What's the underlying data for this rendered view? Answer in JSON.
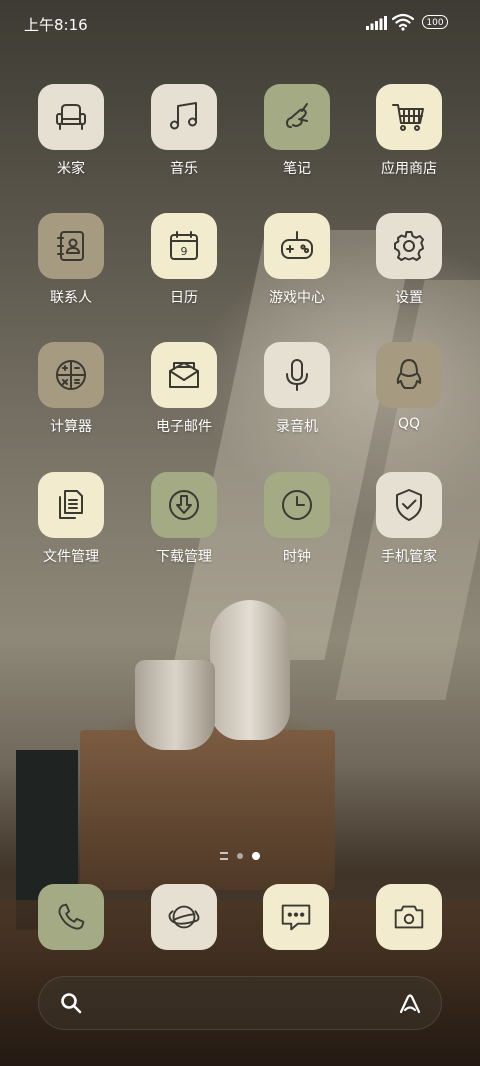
{
  "status": {
    "time": "上午8:16",
    "battery": "100"
  },
  "apps": [
    {
      "label": "米家",
      "icon": "mijia-chair-icon"
    },
    {
      "label": "音乐",
      "icon": "music-note-icon"
    },
    {
      "label": "笔记",
      "icon": "notes-icon"
    },
    {
      "label": "应用商店",
      "icon": "shopping-cart-icon"
    },
    {
      "label": "联系人",
      "icon": "contacts-book-icon"
    },
    {
      "label": "日历",
      "icon": "calendar-icon",
      "date": "9"
    },
    {
      "label": "游戏中心",
      "icon": "gamepad-icon"
    },
    {
      "label": "设置",
      "icon": "gear-icon"
    },
    {
      "label": "计算器",
      "icon": "calculator-icon"
    },
    {
      "label": "电子邮件",
      "icon": "email-icon"
    },
    {
      "label": "录音机",
      "icon": "microphone-icon"
    },
    {
      "label": "QQ",
      "icon": "qq-penguin-icon"
    },
    {
      "label": "文件管理",
      "icon": "files-icon"
    },
    {
      "label": "下载管理",
      "icon": "download-icon"
    },
    {
      "label": "时钟",
      "icon": "clock-icon"
    },
    {
      "label": "手机管家",
      "icon": "shield-check-icon"
    }
  ],
  "dock": [
    {
      "icon": "phone-icon"
    },
    {
      "icon": "browser-planet-icon"
    },
    {
      "icon": "message-icon"
    },
    {
      "icon": "camera-icon"
    }
  ],
  "search": {
    "placeholder": ""
  },
  "colors": {
    "cream": "#f3ebce",
    "light": "#e6e0d3",
    "sage": "#a3aa84",
    "khaki": "#a69a80",
    "iconStroke": "#3a3a32"
  }
}
